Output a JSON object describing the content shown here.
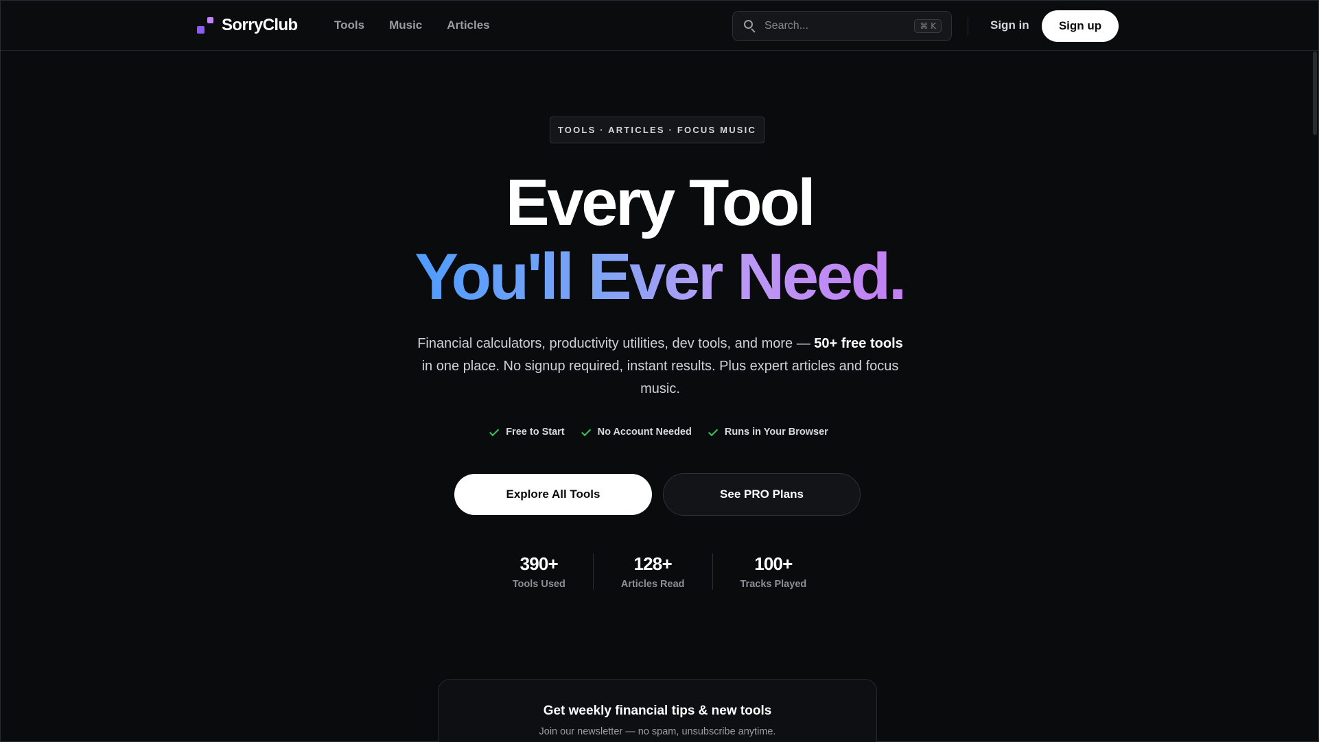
{
  "brand": {
    "name": "SorryClub"
  },
  "nav": {
    "items": [
      "Tools",
      "Music",
      "Articles"
    ]
  },
  "search": {
    "placeholder": "Search...",
    "shortcut": "⌘ K"
  },
  "auth": {
    "sign_in": "Sign in",
    "sign_up": "Sign up"
  },
  "hero": {
    "eyebrow": "TOOLS · ARTICLES · FOCUS MUSIC",
    "title_line1": "Every Tool",
    "title_line2": "You'll Ever Need.",
    "lede_pre": "Financial calculators, productivity utilities, dev tools, and more — ",
    "lede_bold": "50+ free tools",
    "lede_post": " in one place. No signup required, instant results. Plus expert articles and focus music.",
    "checks": [
      "Free to Start",
      "No Account Needed",
      "Runs in Your Browser"
    ],
    "primary_cta": "Explore All Tools",
    "secondary_cta": "See PRO Plans"
  },
  "stats": [
    {
      "value": "390+",
      "label": "Tools Used"
    },
    {
      "value": "128+",
      "label": "Articles Read"
    },
    {
      "value": "100+",
      "label": "Tracks Played"
    }
  ],
  "newsletter": {
    "title": "Get weekly financial tips & new tools",
    "subtitle": "Join our newsletter — no spam, unsubscribe anytime."
  },
  "colors": {
    "accent_purple": "#8b5cf6",
    "gradient_start": "#4f9cff",
    "gradient_end": "#c27ff2",
    "check_green": "#34c759",
    "background": "#0a0b0d"
  }
}
